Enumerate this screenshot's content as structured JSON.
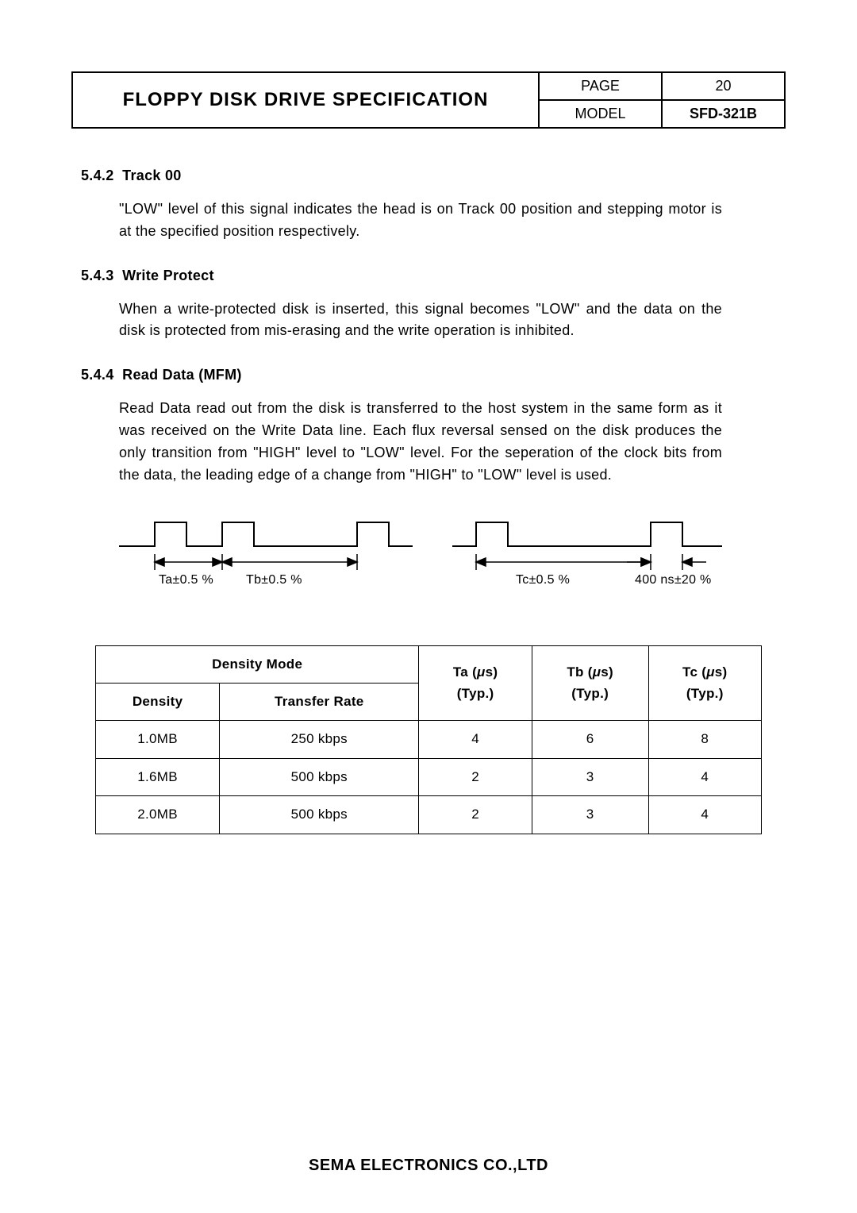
{
  "header": {
    "title": "FLOPPY  DISK  DRIVE  SPECIFICATION",
    "page_label": "PAGE",
    "page_number": "20",
    "model_label": "MODEL",
    "model_value": "SFD-321B"
  },
  "sections": {
    "s542": {
      "num": "5.4.2",
      "title": "Track 00",
      "body": "\"LOW\"  level  of  this  signal  indicates  the  head  is  on  Track  00  position and  stepping  motor  is  at  the  specified  position  respectively."
    },
    "s543": {
      "num": "5.4.3",
      "title": "Write  Protect",
      "body": "When  a  write-protected  disk  is  inserted,  this  signal  becomes  \"LOW\" and  the  data  on  the  disk  is  protected  from  mis-erasing  and the  write  operation  is  inhibited."
    },
    "s544": {
      "num": "5.4.4",
      "title": "Read  Data  (MFM)",
      "body": "Read  Data  read  out  from  the  disk  is  transferred  to  the  host  system in  the  same  form  as  it  was  received  on  the  Write  Data  line.  Each  flux reversal  sensed  on  the  disk  produces  the  only  transition  from  \"HIGH\" level  to  \"LOW\"  level.    For  the  seperation  of  the  clock  bits  from  the  data, the  leading  edge  of  a  change  from  \"HIGH\"  to  \"LOW\"  level  is  used."
    }
  },
  "timing_labels": {
    "ta": "Ta±0.5 %",
    "tb": "Tb±0.5 %",
    "tc": "Tc±0.5 %",
    "pulse": "400 ns±20 %"
  },
  "table": {
    "header": {
      "mode_group": "Density  Mode",
      "density": "Density",
      "transfer": "Transfer  Rate",
      "ta_l1": "Ta  (",
      "ta_l2": "s)",
      "tb_l1": "Tb  (",
      "tb_l2": "s)",
      "tc_l1": "Tc  (",
      "tc_l2": "s)",
      "typ": "(Typ.)"
    },
    "rows": [
      {
        "density": "1.0MB",
        "rate": "250  kbps",
        "ta": "4",
        "tb": "6",
        "tc": "8"
      },
      {
        "density": "1.6MB",
        "rate": "500  kbps",
        "ta": "2",
        "tb": "3",
        "tc": "4"
      },
      {
        "density": "2.0MB",
        "rate": "500  kbps",
        "ta": "2",
        "tb": "3",
        "tc": "4"
      }
    ]
  },
  "footer": "SEMA    ELECTRONICS  CO.,LTD"
}
